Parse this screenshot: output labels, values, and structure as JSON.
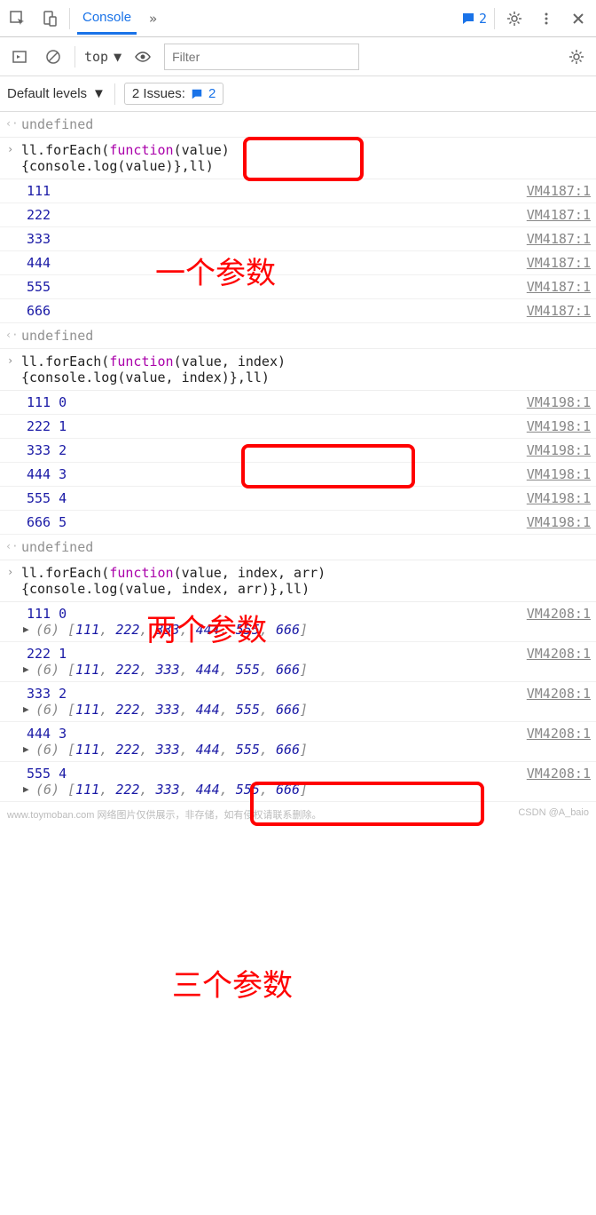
{
  "toolbar": {
    "console_tab": "Console",
    "badge_count": "2",
    "context": "top",
    "filter_placeholder": "Filter",
    "levels": "Default levels",
    "issues_label": "2 Issues:",
    "issues_count": "2"
  },
  "logs": {
    "undefined": "undefined",
    "cmd1_a": "ll.forEach(",
    "cmd1_fn": "function",
    "cmd1_b": "(value)",
    "cmd1_c": "{console.log(value)},ll)",
    "out1": [
      {
        "v": "111",
        "src": "VM4187:1",
        "hi": false
      },
      {
        "v": "222",
        "src": "VM4187:1",
        "hi": false
      },
      {
        "v": "333",
        "src": "VM4187:1",
        "hi": true
      },
      {
        "v": "444",
        "src": "VM4187:1",
        "hi": false
      },
      {
        "v": "555",
        "src": "VM4187:1",
        "hi": false
      },
      {
        "v": "666",
        "src": "VM4187:1",
        "hi": false
      }
    ],
    "cmd2_a": "ll.forEach(",
    "cmd2_b": "(value, index)",
    "cmd2_c": "{console.log(value, index)},ll)",
    "out2": [
      {
        "v": "111 0",
        "src": "VM4198:1"
      },
      {
        "v": "222 1",
        "src": "VM4198:1"
      },
      {
        "v": "333 2",
        "src": "VM4198:1"
      },
      {
        "v": "444 3",
        "src": "VM4198:1"
      },
      {
        "v": "555 4",
        "src": "VM4198:1"
      },
      {
        "v": "666 5",
        "src": "VM4198:1"
      }
    ],
    "cmd3_a": "ll.forEach(",
    "cmd3_b": "(value, index, arr)",
    "cmd3_c": "{console.log(value, index, arr)},ll)",
    "arr_len": "(6)",
    "arr_body": " [111, 222, 333, 444, 555, 666]",
    "out3": [
      {
        "v": "111 0",
        "src": "VM4208:1"
      },
      {
        "v": "222 1",
        "src": "VM4208:1"
      },
      {
        "v": "333 2",
        "src": "VM4208:1"
      },
      {
        "v": "444 3",
        "src": "VM4208:1"
      },
      {
        "v": "555 4",
        "src": "VM4208:1"
      }
    ]
  },
  "annotations": {
    "a1": "一个参数",
    "a2": "两个参数",
    "a3": "三个参数"
  },
  "footer": {
    "left": "www.toymoban.com  网络图片仅供展示，非存储，如有侵权请联系删除。",
    "right": "CSDN @A_baio"
  }
}
